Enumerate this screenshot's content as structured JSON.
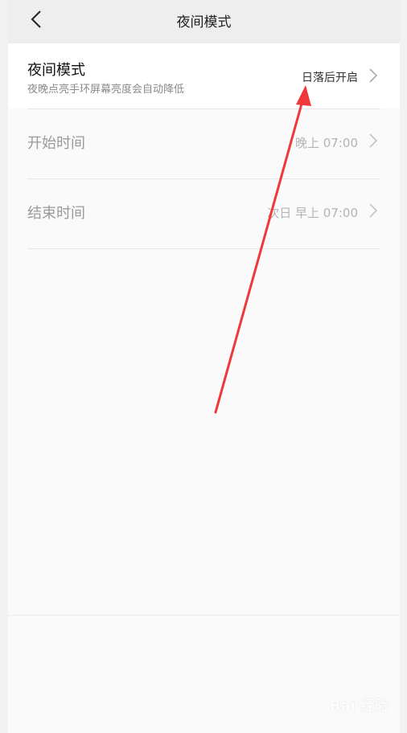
{
  "header": {
    "title": "夜间模式",
    "back_icon": "chevron-left-icon"
  },
  "night_mode": {
    "title": "夜间模式",
    "subtitle": "夜晚点亮手环屏幕亮度会自动降低",
    "value": "日落后开启",
    "icon": "chevron-right-icon"
  },
  "start_time": {
    "label": "开始时间",
    "value": "晚上 07:00",
    "icon": "chevron-right-icon"
  },
  "end_time": {
    "label": "结束时间",
    "value": "次日 早上 07:00",
    "icon": "chevron-right-icon"
  },
  "colors": {
    "annotation_arrow": "#f0383a",
    "header_bg": "#eeeeee",
    "page_bg": "#fafafa"
  },
  "watermark": {
    "text": "Bai 经验"
  }
}
